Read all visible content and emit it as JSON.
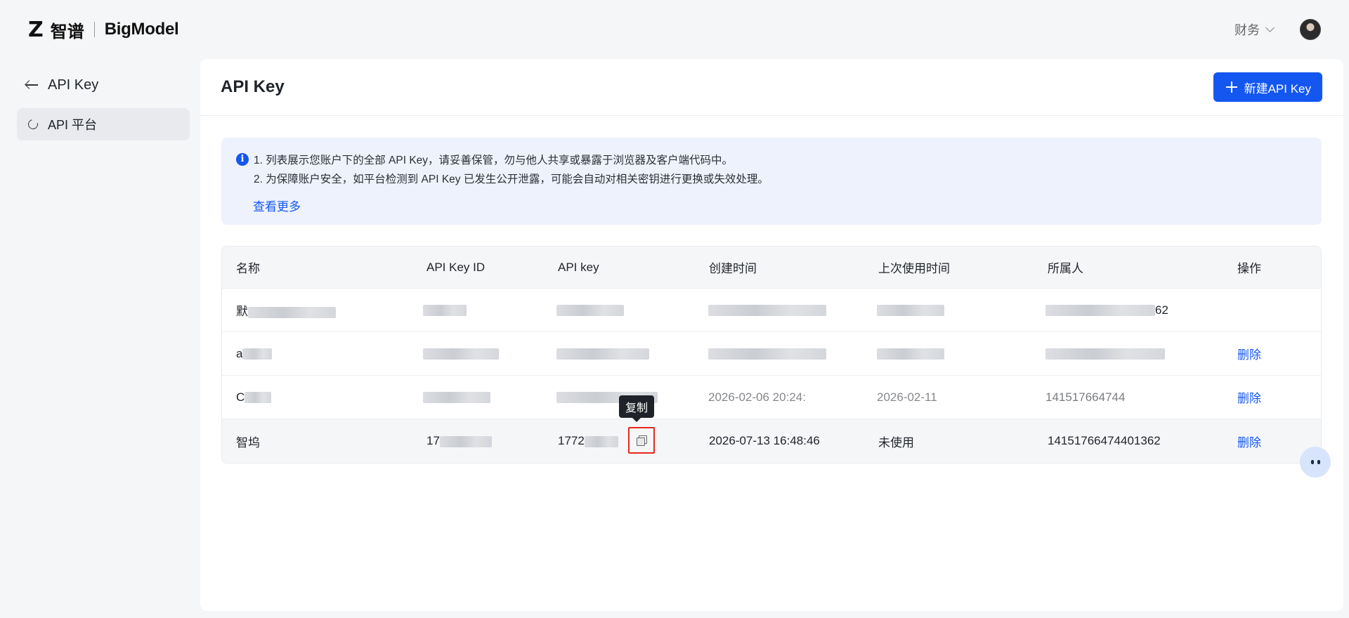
{
  "brand": {
    "mark": "Z",
    "cn": "智谱",
    "en": "BigModel"
  },
  "header": {
    "finance_label": "财务"
  },
  "sidebar": {
    "back_label": "API Key",
    "items": [
      {
        "label": "API 平台"
      }
    ]
  },
  "main": {
    "title": "API Key",
    "new_button_label": "新建API Key",
    "notice": {
      "icon_glyph": "i",
      "line1": "1. 列表展示您账户下的全部 API Key，请妥善保管，勿与他人共享或暴露于浏览器及客户端代码中。",
      "line2": "2. 为保障账户安全，如平台检测到 API Key 已发生公开泄露，可能会自动对相关密钥进行更换或失效处理。",
      "link": "查看更多"
    },
    "table": {
      "columns": [
        "名称",
        "API Key ID",
        "API key",
        "创建时间",
        "上次使用时间",
        "所属人",
        "操作"
      ],
      "rows": [
        {
          "name": "默",
          "key_id": "",
          "api_key": "",
          "created": "",
          "last_used": "",
          "owner": "62",
          "action": ""
        },
        {
          "name": "a",
          "key_id": "",
          "api_key": "",
          "created": "",
          "last_used": "",
          "owner": "",
          "action": "删除"
        },
        {
          "name": "C",
          "key_id": "",
          "api_key": "",
          "created": "2026-02-06 20:24:",
          "last_used": "2026-02-11",
          "owner": "141517664744",
          "action": "删除"
        },
        {
          "name": "智坞",
          "key_id": "17",
          "api_key": "1772",
          "created": "2026-07-13 16:48:46",
          "last_used": "未使用",
          "owner": "14151766474401362",
          "action": "删除"
        }
      ]
    },
    "tooltip": "复制"
  }
}
